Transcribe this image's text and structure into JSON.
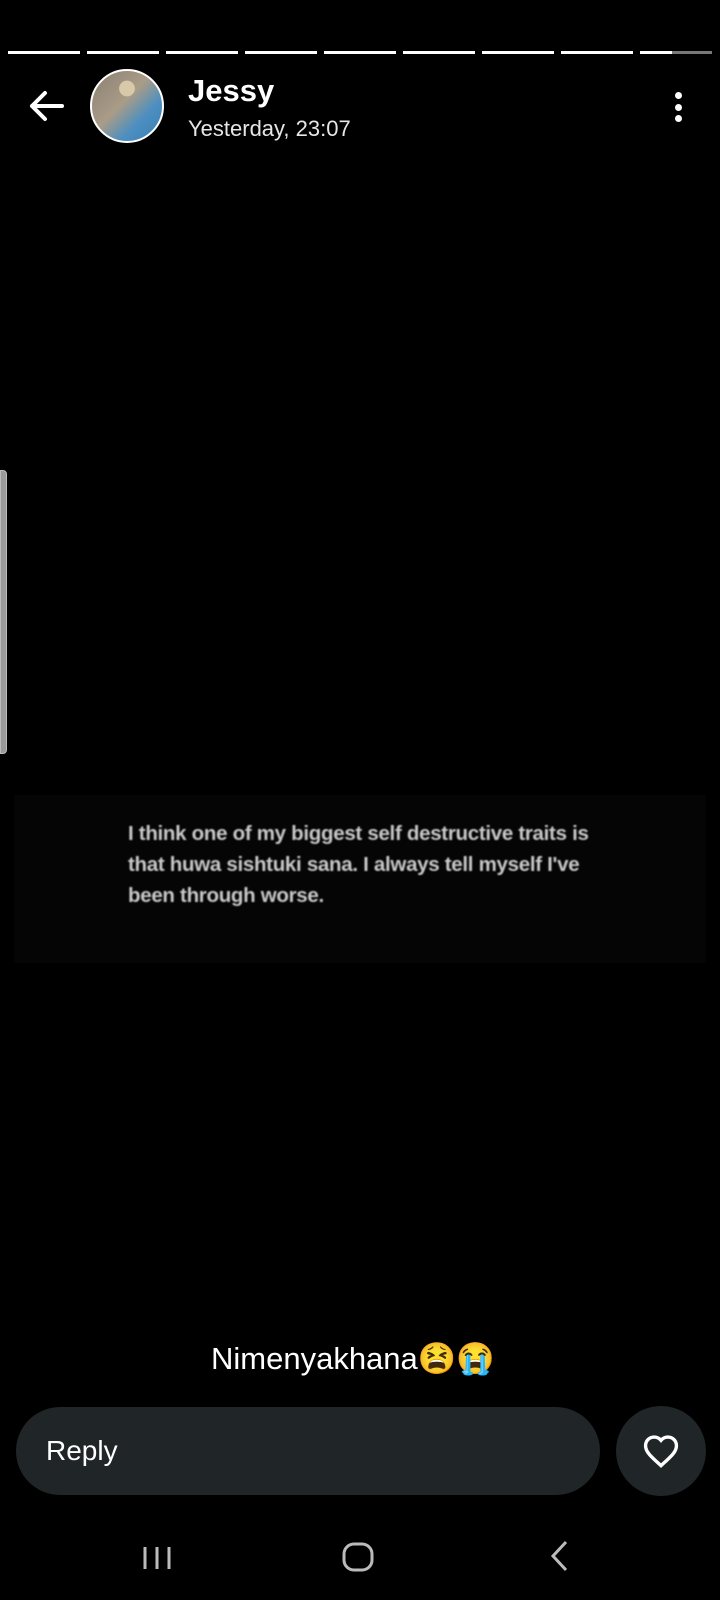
{
  "story": {
    "segments_total": 9,
    "current_segment": 9,
    "current_segment_progress": 0.45,
    "user_name": "Jessy",
    "timestamp": "Yesterday, 23:07",
    "post_text": "I think one of my biggest self destructive traits is that huwa sishtuki sana. I always tell myself I've been through worse.",
    "caption": "Nimenyakhana😫😭"
  },
  "reply": {
    "placeholder": "Reply"
  },
  "icons": {
    "back": "arrow-left-icon",
    "more": "more-vertical-icon",
    "like": "heart-outline-icon"
  }
}
